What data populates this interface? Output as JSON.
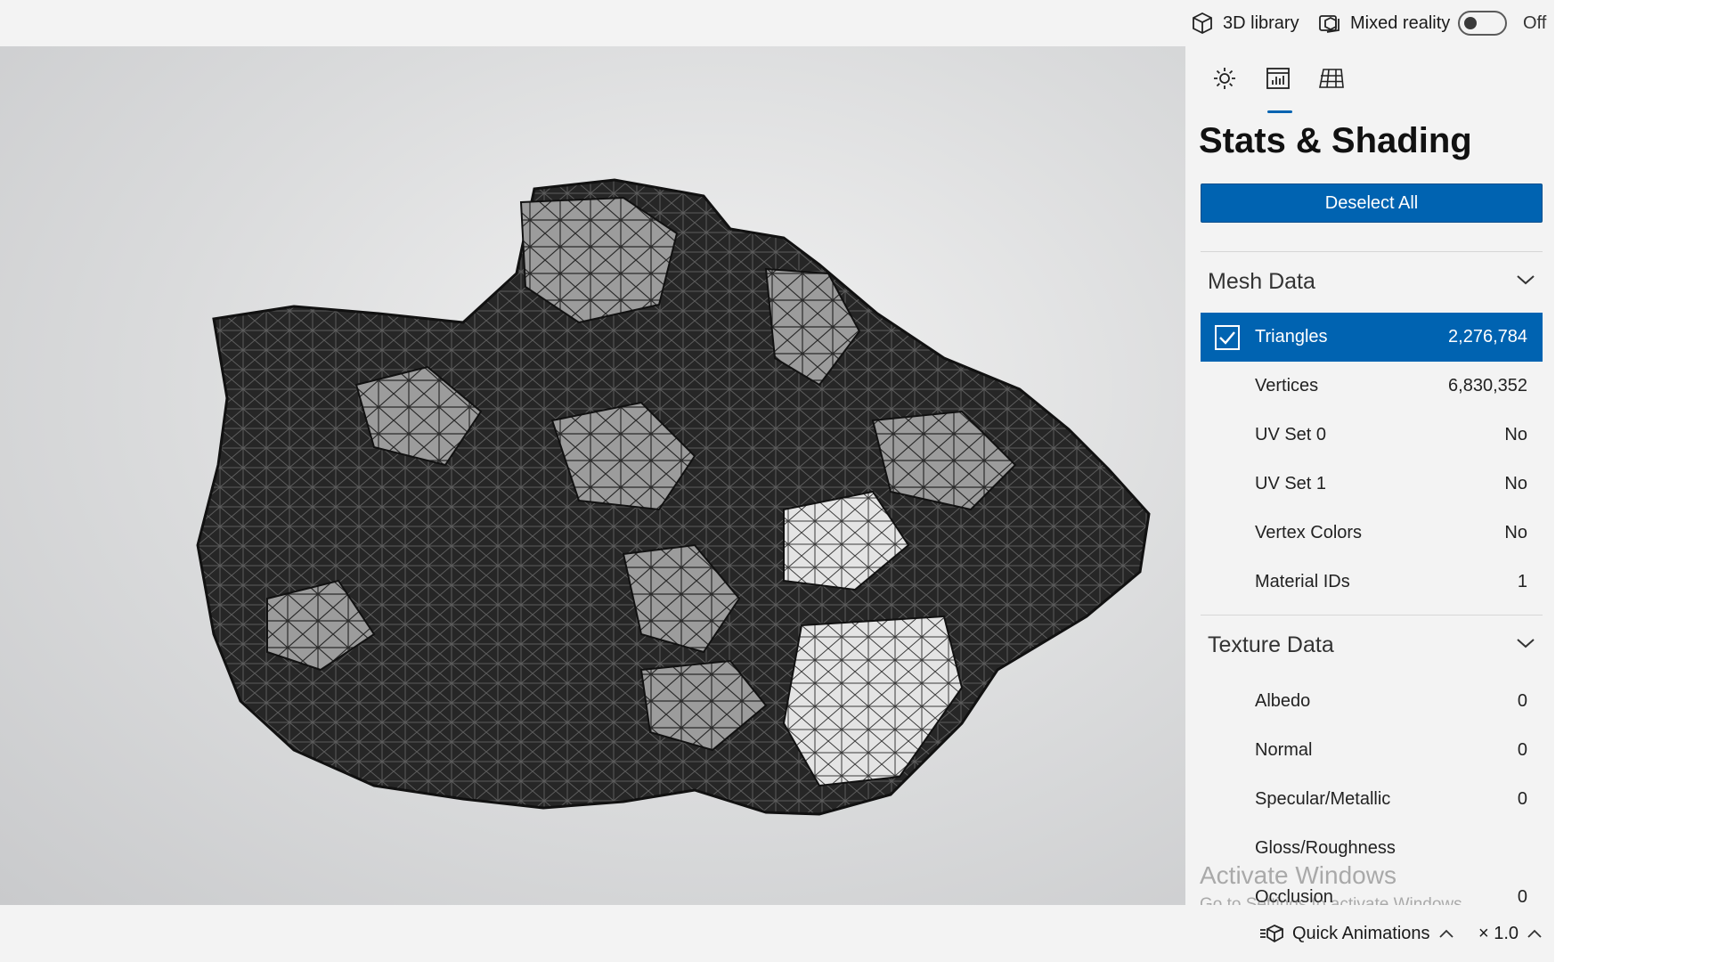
{
  "topbar": {
    "library_label": "3D library",
    "mixed_reality_label": "Mixed reality",
    "toggle_state": "Off"
  },
  "panel": {
    "tabs": [
      {
        "icon": "lighting-icon",
        "active": false
      },
      {
        "icon": "stats-icon",
        "active": true
      },
      {
        "icon": "grid-icon",
        "active": false
      }
    ],
    "title": "Stats & Shading",
    "deselect_label": "Deselect All",
    "mesh": {
      "header": "Mesh Data",
      "rows": [
        {
          "name": "Triangles",
          "value": "2,276,784",
          "checked": true
        },
        {
          "name": "Vertices",
          "value": "6,830,352",
          "checked": false
        },
        {
          "name": "UV Set 0",
          "value": "No",
          "checked": false
        },
        {
          "name": "UV Set 1",
          "value": "No",
          "checked": false
        },
        {
          "name": "Vertex Colors",
          "value": "No",
          "checked": false
        },
        {
          "name": "Material IDs",
          "value": "1",
          "checked": false
        }
      ]
    },
    "texture": {
      "header": "Texture Data",
      "rows": [
        {
          "name": "Albedo",
          "value": "0"
        },
        {
          "name": "Normal",
          "value": "0"
        },
        {
          "name": "Specular/Metallic",
          "value": "0"
        },
        {
          "name": "Gloss/Roughness",
          "value": ""
        },
        {
          "name": "Occlusion",
          "value": "0"
        }
      ]
    }
  },
  "watermark": {
    "line1": "Activate Windows",
    "line2": "Go to Settings to activate Windows."
  },
  "bottombar": {
    "animations_label": "Quick Animations",
    "speed_label": "× 1.0"
  },
  "colors": {
    "accent": "#0063b1",
    "background": "#f3f3f3"
  }
}
